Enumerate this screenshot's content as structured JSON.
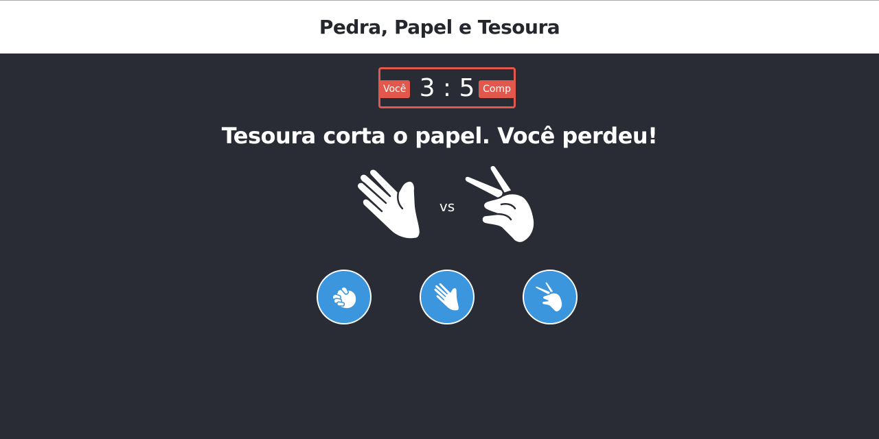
{
  "header": {
    "title": "Pedra, Papel e Tesoura"
  },
  "scoreboard": {
    "user_label": "Você",
    "computer_label": "Comp",
    "user_score": "3",
    "separator": ":",
    "computer_score": "5"
  },
  "result": {
    "message": "Tesoura corta o papel. Você perdeu!"
  },
  "match": {
    "user_choice_icon": "paper-hand-icon",
    "vs_label": "vs",
    "computer_choice_icon": "scissors-hand-icon"
  },
  "choices": [
    {
      "name": "rock",
      "icon": "rock-fist-icon"
    },
    {
      "name": "paper",
      "icon": "paper-hand-icon"
    },
    {
      "name": "scissors",
      "icon": "scissors-hand-icon"
    }
  ],
  "colors": {
    "header_bg": "#ffffff",
    "page_bg": "#2a2c35",
    "accent_red": "#e2584d",
    "choice_blue": "#3b96dd",
    "text_light": "#ffffff",
    "text_dark": "#24272e"
  }
}
